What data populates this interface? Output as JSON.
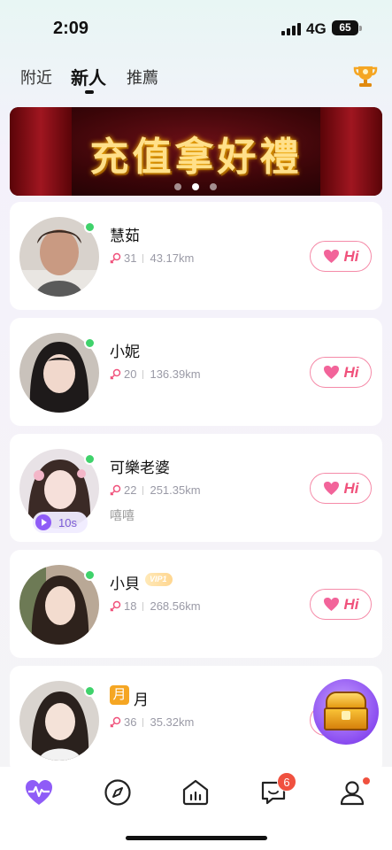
{
  "status_bar": {
    "time": "2:09",
    "network": "4G",
    "battery": "65"
  },
  "tabs": [
    {
      "label": "附近",
      "active": false
    },
    {
      "label": "新人",
      "active": true
    },
    {
      "label": "推薦",
      "active": false
    }
  ],
  "banner": {
    "text": "充值拿好禮",
    "dots": 3,
    "active_dot": 1
  },
  "users": [
    {
      "name": "慧茹",
      "age": "31",
      "distance": "43.17km",
      "bio": "",
      "online": true,
      "hi_label": "Hi"
    },
    {
      "name": "小妮",
      "age": "20",
      "distance": "136.39km",
      "bio": "",
      "online": true,
      "hi_label": "Hi"
    },
    {
      "name": "可樂老婆",
      "age": "22",
      "distance": "251.35km",
      "bio": "嘻嘻",
      "video_length": "10s",
      "online": true,
      "hi_label": "Hi"
    },
    {
      "name": "小貝",
      "age": "18",
      "distance": "268.56km",
      "bio": "",
      "vip": "VIP1",
      "online": true,
      "hi_label": "Hi"
    },
    {
      "name": "月",
      "name_tag": "月",
      "age": "36",
      "distance": "35.32km",
      "bio": "",
      "online": true,
      "hi_label": "Hi"
    }
  ],
  "bottom_nav": {
    "items": [
      "heart-pulse-icon",
      "compass-icon",
      "home-icon",
      "chat-icon",
      "profile-icon"
    ],
    "messages_badge": "6"
  },
  "colors": {
    "accent": "#f0527c",
    "online": "#3fd26b",
    "nav_active": "#8f5cf7",
    "badge": "#f0513f"
  }
}
